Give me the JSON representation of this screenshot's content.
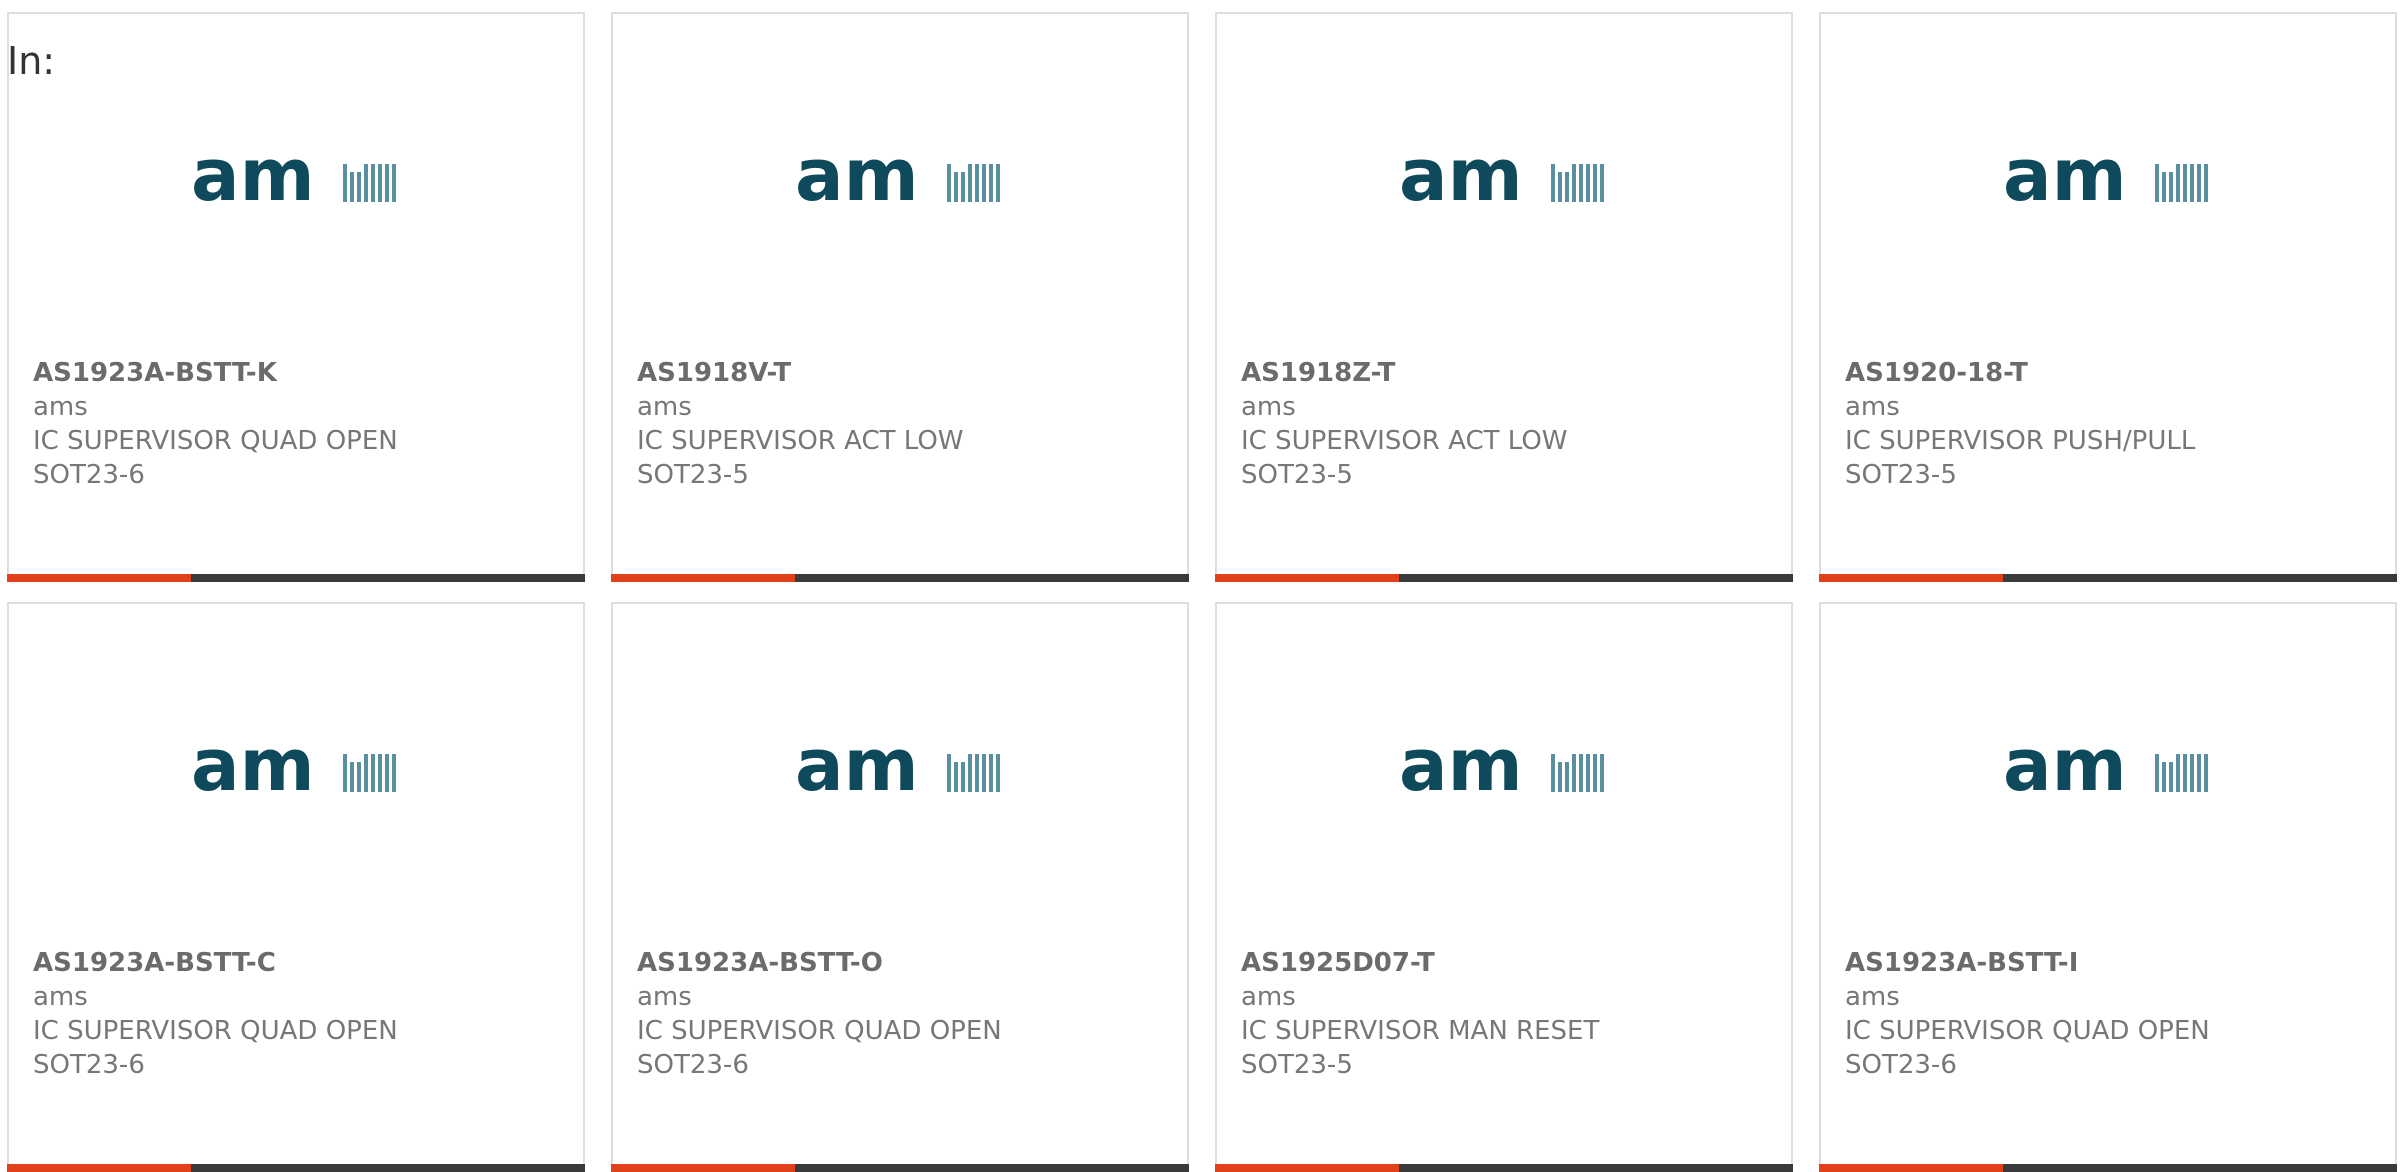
{
  "header": {
    "in_label": "In:"
  },
  "brand": {
    "logo_text": "am",
    "logo_color": "#0f4a5c"
  },
  "colors": {
    "accent": "#e0401a",
    "bar": "#3a3a3a"
  },
  "products": [
    {
      "part_number": "AS1923A-BSTT-K",
      "manufacturer": "ams",
      "description": "IC SUPERVISOR QUAD OPEN",
      "package": "SOT23-6"
    },
    {
      "part_number": "AS1918V-T",
      "manufacturer": "ams",
      "description": "IC SUPERVISOR ACT LOW",
      "package": "SOT23-5"
    },
    {
      "part_number": "AS1918Z-T",
      "manufacturer": "ams",
      "description": "IC SUPERVISOR ACT LOW",
      "package": "SOT23-5"
    },
    {
      "part_number": "AS1920-18-T",
      "manufacturer": "ams",
      "description": "IC SUPERVISOR PUSH/PULL",
      "package": "SOT23-5"
    },
    {
      "part_number": "AS1923A-BSTT-C",
      "manufacturer": "ams",
      "description": "IC SUPERVISOR QUAD OPEN",
      "package": "SOT23-6"
    },
    {
      "part_number": "AS1923A-BSTT-O",
      "manufacturer": "ams",
      "description": "IC SUPERVISOR QUAD OPEN",
      "package": "SOT23-6"
    },
    {
      "part_number": "AS1925D07-T",
      "manufacturer": "ams",
      "description": "IC SUPERVISOR MAN RESET",
      "package": "SOT23-5"
    },
    {
      "part_number": "AS1923A-BSTT-I",
      "manufacturer": "ams",
      "description": "IC SUPERVISOR QUAD OPEN",
      "package": "SOT23-6"
    }
  ]
}
